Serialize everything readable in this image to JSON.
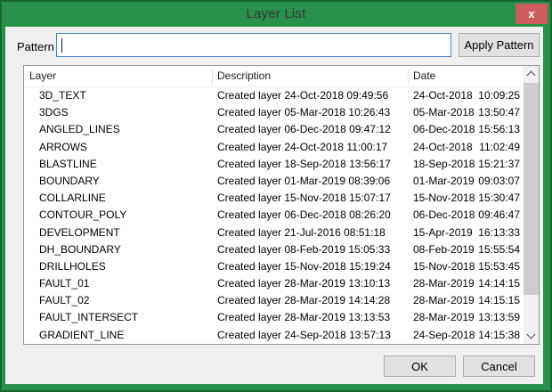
{
  "window": {
    "title": "Layer List"
  },
  "titlebar": {
    "close_glyph": "x"
  },
  "pattern": {
    "label": "Pattern",
    "value": "",
    "apply_label": "Apply Pattern"
  },
  "table": {
    "columns": [
      {
        "key": "layer",
        "label": "Layer"
      },
      {
        "key": "description",
        "label": "Description"
      },
      {
        "key": "date",
        "label": "Date"
      }
    ],
    "rows": [
      {
        "layer": "3D_TEXT",
        "description": "Created layer 24-Oct-2018 09:49:56",
        "date": "24-Oct-2018",
        "time": "10:09:25"
      },
      {
        "layer": "3DGS",
        "description": "Created layer 05-Mar-2018 10:26:43",
        "date": "05-Mar-2018",
        "time": "13:50:47"
      },
      {
        "layer": "ANGLED_LINES",
        "description": "Created layer 06-Dec-2018 09:47:12",
        "date": "06-Dec-2018",
        "time": "15:56:13"
      },
      {
        "layer": "ARROWS",
        "description": "Created layer 24-Oct-2018 11:00:17",
        "date": "24-Oct-2018",
        "time": "11:02:49"
      },
      {
        "layer": "BLASTLINE",
        "description": "Created layer 18-Sep-2018 13:56:17",
        "date": "18-Sep-2018",
        "time": "15:21:37"
      },
      {
        "layer": "BOUNDARY",
        "description": "Created layer 01-Mar-2019 08:39:06",
        "date": "01-Mar-2019",
        "time": "09:03:07"
      },
      {
        "layer": "COLLARLINE",
        "description": "Created layer 15-Nov-2018 15:07:17",
        "date": "15-Nov-2018",
        "time": "15:30:47"
      },
      {
        "layer": "CONTOUR_POLY",
        "description": "Created layer 06-Dec-2018 08:26:20",
        "date": "06-Dec-2018",
        "time": "09:46:47"
      },
      {
        "layer": "DEVELOPMENT",
        "description": "Created layer 21-Jul-2016 08:51:18",
        "date": "15-Apr-2019",
        "time": "16:13:33"
      },
      {
        "layer": "DH_BOUNDARY",
        "description": "Created layer 08-Feb-2019 15:05:33",
        "date": "08-Feb-2019",
        "time": "15:55:54"
      },
      {
        "layer": "DRILLHOLES",
        "description": "Created layer 15-Nov-2018 15:19:24",
        "date": "15-Nov-2018",
        "time": "15:53:45"
      },
      {
        "layer": "FAULT_01",
        "description": "Created layer 28-Mar-2019 13:10:13",
        "date": "28-Mar-2019",
        "time": "14:14:15"
      },
      {
        "layer": "FAULT_02",
        "description": "Created layer 28-Mar-2019 14:14:28",
        "date": "28-Mar-2019",
        "time": "14:15:15"
      },
      {
        "layer": "FAULT_INTERSECT",
        "description": "Created layer 28-Mar-2019 13:13:53",
        "date": "28-Mar-2019",
        "time": "13:13:59"
      },
      {
        "layer": "GRADIENT_LINE",
        "description": "Created layer 24-Sep-2018 13:57:13",
        "date": "24-Sep-2018",
        "time": "14:15:38"
      }
    ]
  },
  "footer": {
    "ok_label": "OK",
    "cancel_label": "Cancel"
  },
  "colors": {
    "title_green": "#28924b",
    "title_green_dark": "#15662f",
    "close_red": "#cd5c5c",
    "body_bg": "#f0f0f0",
    "focus_border": "#4d82c4"
  }
}
